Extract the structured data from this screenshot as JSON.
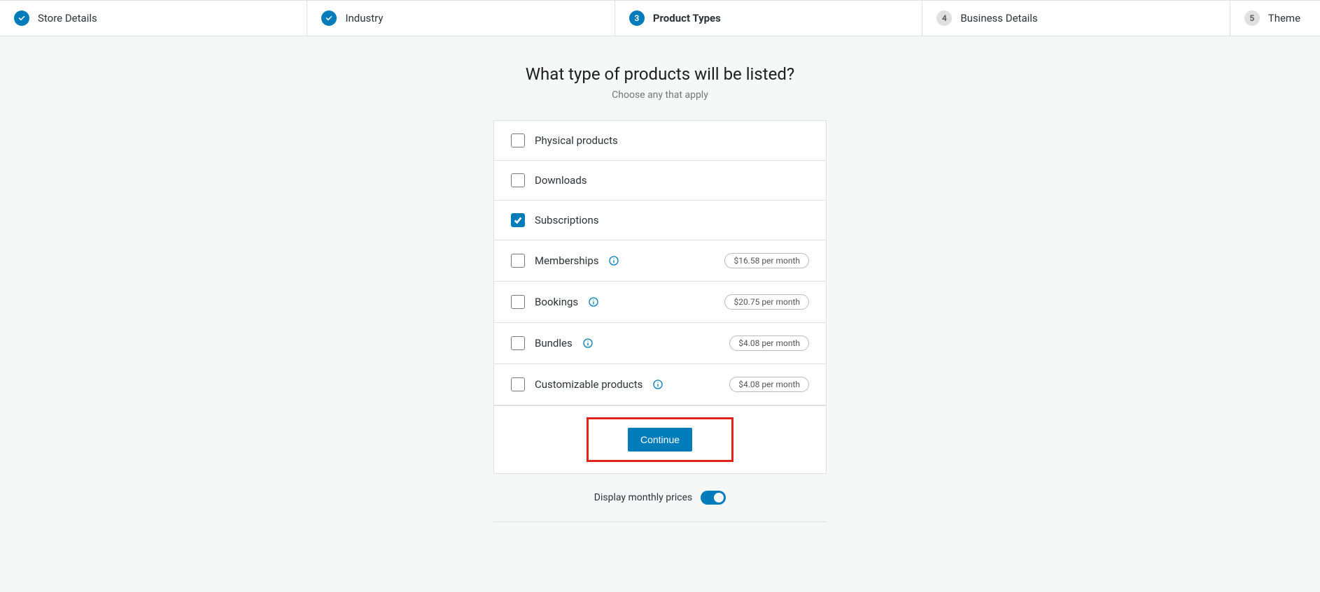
{
  "stepper": {
    "steps": [
      {
        "label": "Store Details",
        "status": "done"
      },
      {
        "label": "Industry",
        "status": "done"
      },
      {
        "label": "Product Types",
        "status": "active",
        "number": "3"
      },
      {
        "label": "Business Details",
        "status": "pending",
        "number": "4"
      },
      {
        "label": "Theme",
        "status": "pending",
        "number": "5"
      }
    ]
  },
  "header": {
    "title": "What type of products will be listed?",
    "subtitle": "Choose any that apply"
  },
  "options": [
    {
      "id": "physical",
      "label": "Physical products",
      "checked": false,
      "info": false,
      "price": null
    },
    {
      "id": "downloads",
      "label": "Downloads",
      "checked": false,
      "info": false,
      "price": null
    },
    {
      "id": "subscriptions",
      "label": "Subscriptions",
      "checked": true,
      "info": false,
      "price": null
    },
    {
      "id": "memberships",
      "label": "Memberships",
      "checked": false,
      "info": true,
      "price": "$16.58 per month"
    },
    {
      "id": "bookings",
      "label": "Bookings",
      "checked": false,
      "info": true,
      "price": "$20.75 per month"
    },
    {
      "id": "bundles",
      "label": "Bundles",
      "checked": false,
      "info": true,
      "price": "$4.08 per month"
    },
    {
      "id": "customizable",
      "label": "Customizable products",
      "checked": false,
      "info": true,
      "price": "$4.08 per month"
    }
  ],
  "actions": {
    "continue": "Continue"
  },
  "toggle": {
    "label": "Display monthly prices",
    "enabled": true
  }
}
